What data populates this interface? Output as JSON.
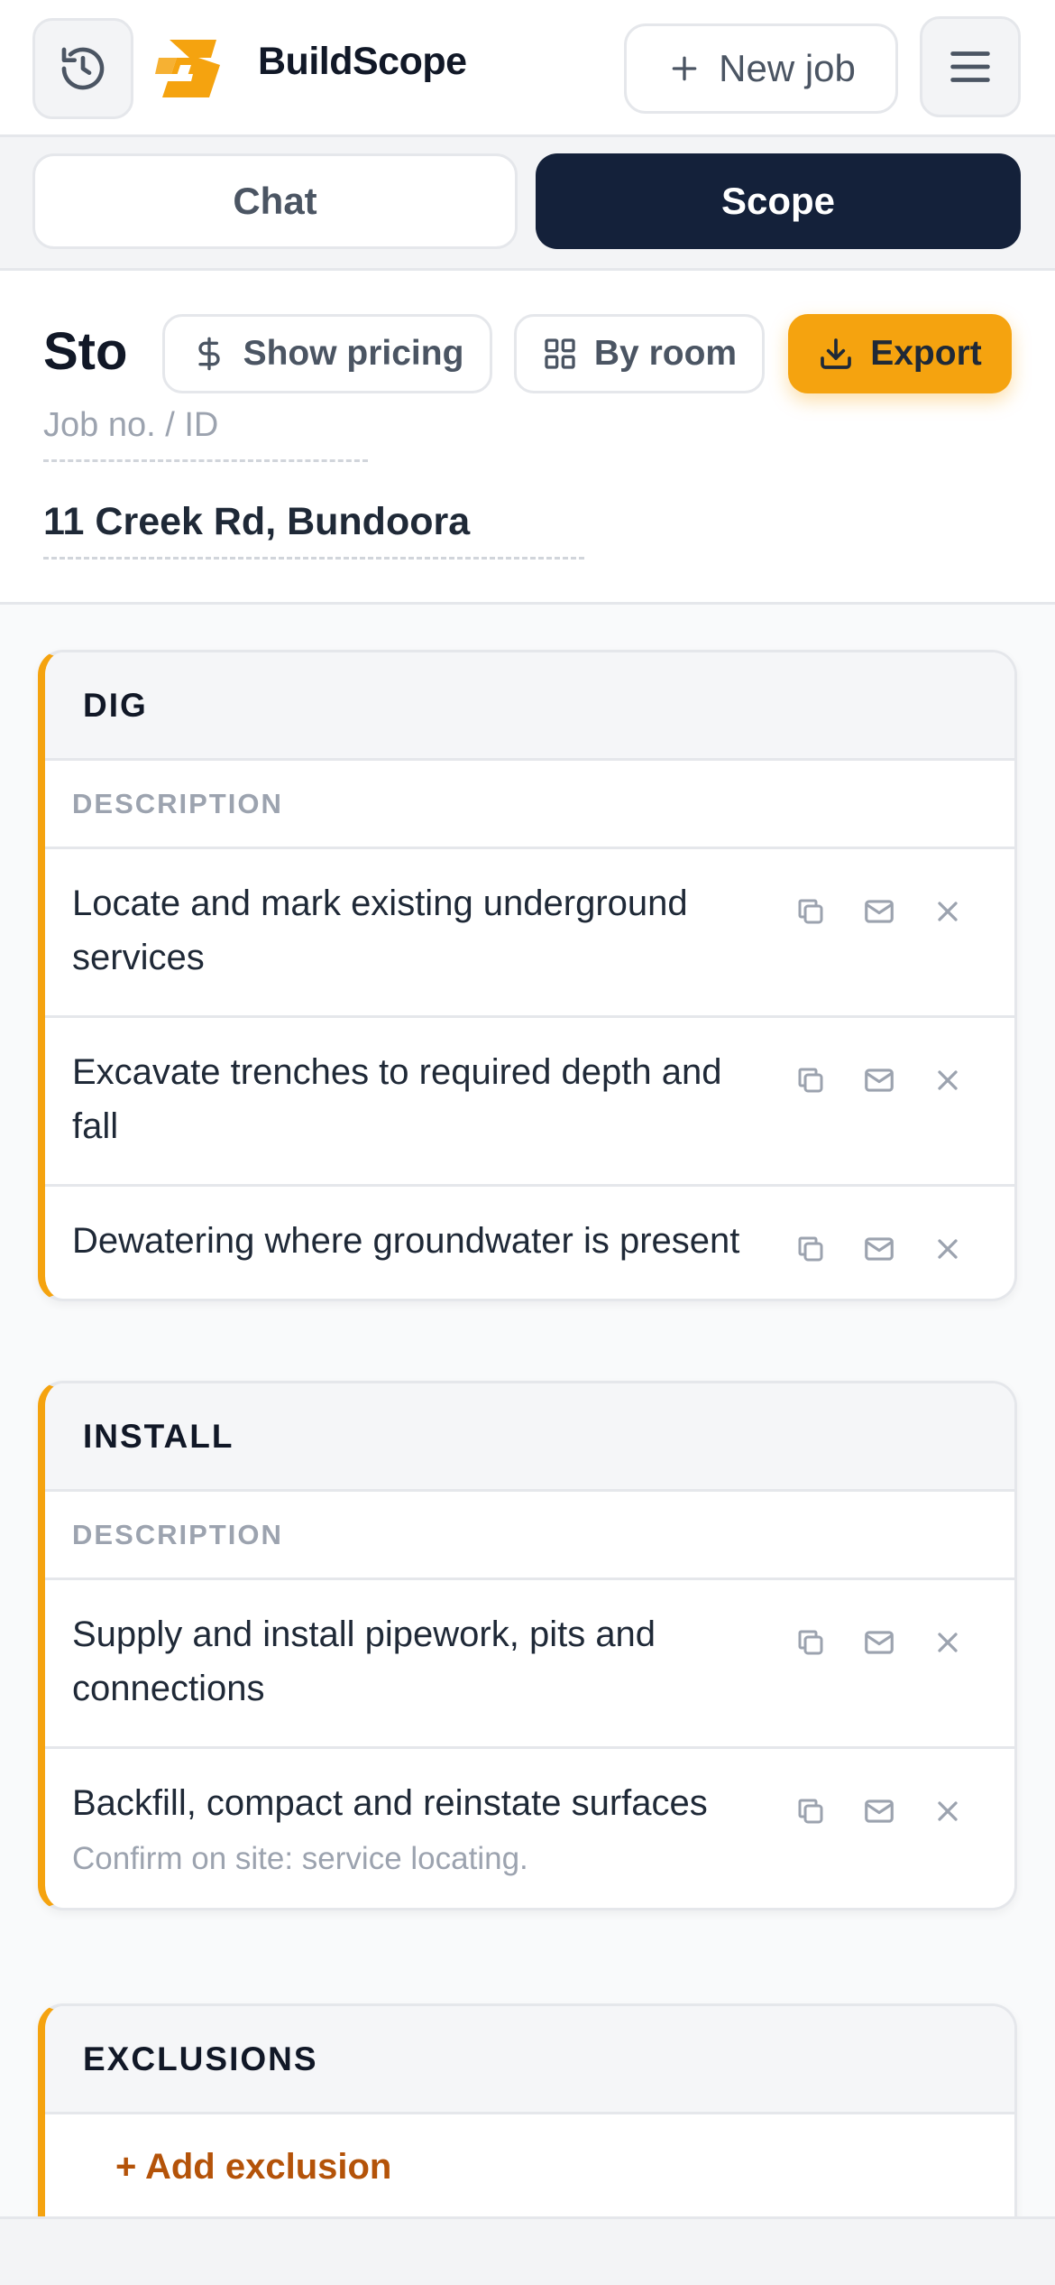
{
  "header": {
    "brand": "BuildScope",
    "new_job_label": "New job",
    "history_icon": "history-icon",
    "menu_icon": "menu-icon"
  },
  "tabs": [
    {
      "label": "Chat",
      "active": false
    },
    {
      "label": "Scope",
      "active": true
    }
  ],
  "toolbar": {
    "title": "Sto",
    "show_pricing_label": "Show pricing",
    "by_room_label": "By room",
    "export_label": "Export"
  },
  "job": {
    "job_no_placeholder": "Job no. / ID",
    "address": "11 Creek Rd, Bundoora"
  },
  "sections": [
    {
      "title": "DIG",
      "column_header": "DESCRIPTION",
      "items": [
        {
          "text": "Locate and mark existing underground services"
        },
        {
          "text": "Excavate trenches to required depth and fall"
        },
        {
          "text": "Dewatering where groundwater is present"
        }
      ]
    },
    {
      "title": "INSTALL",
      "column_header": "DESCRIPTION",
      "items": [
        {
          "text": "Supply and install pipework, pits and connections"
        },
        {
          "text": "Backfill, compact and reinstate surfaces",
          "note": "Confirm on site: service locating."
        }
      ]
    },
    {
      "title": "EXCLUSIONS",
      "add_label": "+ Add exclusion"
    }
  ],
  "colors": {
    "accent": "#f5a30f",
    "dark": "#14213a",
    "exclusion_link": "#b45309"
  }
}
